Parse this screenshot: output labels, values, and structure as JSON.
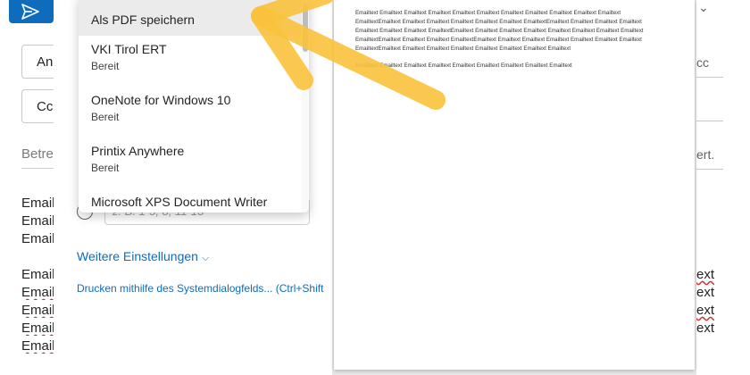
{
  "compose": {
    "to_label": "An",
    "cc_label": "Cc",
    "cc_link": "cc",
    "subject_placeholder": "Betref",
    "subject_right": "ert.",
    "body_left": [
      "Email",
      "Email",
      "Email",
      "Email",
      "Email",
      "Email",
      "Email",
      "Email"
    ],
    "body_right": [
      "ext",
      "ext",
      "ext",
      "ext"
    ]
  },
  "print": {
    "printers": [
      {
        "name": "Als PDF speichern",
        "status": ""
      },
      {
        "name": "VKI Tirol ERT",
        "status": "Bereit"
      },
      {
        "name": "OneNote for Windows 10",
        "status": "Bereit"
      },
      {
        "name": "Printix Anywhere",
        "status": "Bereit"
      },
      {
        "name": "Microsoft XPS Document Writer",
        "status": ""
      }
    ],
    "date_input_value": "z. B. 1-5, 8, 11-13",
    "more_settings": "Weitere Einstellungen",
    "system_dialog": "Drucken mithilfe des Systemdialogfelds... (Ctrl+Shift"
  },
  "preview": {
    "paragraphs": [
      "Emailtext Emailtext Emailtext  Emailtext Emailtext Emailtext  Emailtext Emailtext Emailtext Emailtext Emailtext EmailtextEmailtext Emailtext Emailtext  Emailtext Emailtext Emailtext  EmailtextEmailtext Emailtext Emailtext Emailtext Emailtext Emailtext Emailtext  EmailtextEmailtext Emailtext Emailtext Emailtext Emailtext Emailtext Emailtext Emailtext EmailtextEmailtext Emailtext Emailtext  EmailtextEmailtext Emailtext Emailtext Emailtext Emailtext Emailtext Emailtext  EmailtextEmailtext Emailtext Emailtext Emailtext Emailtext Emailtext Emailtext Emailtext",
      "Emailtext Emailtext  Emailtext Emailtext Emailtext  Emailtext Emailtext Emailtext  Emailtext"
    ]
  },
  "colors": {
    "accent": "#0f6cbd",
    "arrow": "#f9c23c"
  }
}
